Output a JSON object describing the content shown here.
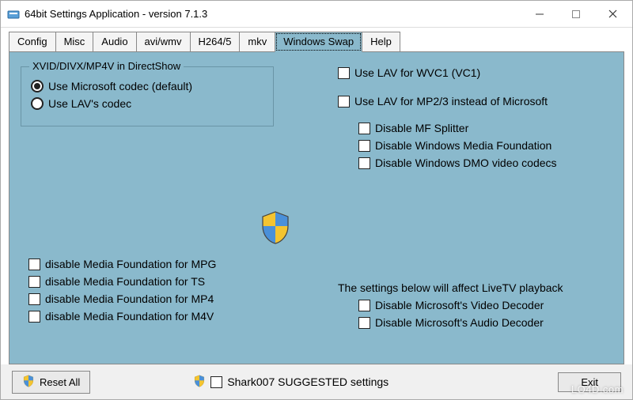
{
  "window": {
    "title": "64bit Settings Application - version 7.1.3"
  },
  "tabs": [
    {
      "label": "Config"
    },
    {
      "label": "Misc"
    },
    {
      "label": "Audio"
    },
    {
      "label": "avi/wmv"
    },
    {
      "label": "H264/5"
    },
    {
      "label": "mkv"
    },
    {
      "label": "Windows Swap"
    },
    {
      "label": "Help"
    }
  ],
  "active_tab_index": 6,
  "group": {
    "legend": "XVID/DIVX/MP4V in DirectShow",
    "radio_ms": "Use Microsoft codec (default)",
    "radio_lav": "Use LAV's codec",
    "selected": "ms"
  },
  "right": {
    "lav_wvc1": "Use LAV for WVC1 (VC1)",
    "lav_mp23": "Use LAV for MP2/3 instead of Microsoft",
    "disable_mf_splitter": "Disable MF Splitter",
    "disable_wmf": "Disable Windows Media Foundation",
    "disable_dmo": "Disable Windows DMO video codecs"
  },
  "left_lower": {
    "mf_mpg": "disable Media Foundation for MPG",
    "mf_ts": "disable Media Foundation for TS",
    "mf_mp4": "disable Media Foundation for MP4",
    "mf_m4v": "disable Media Foundation for M4V"
  },
  "right_lower": {
    "caption": "The settings below will affect LiveTV playback",
    "disable_ms_video": "Disable Microsoft's Video Decoder",
    "disable_ms_audio": "Disable Microsoft's Audio Decoder"
  },
  "footer": {
    "reset_all": "Reset All",
    "suggested": "Shark007 SUGGESTED settings",
    "exit": "Exit"
  },
  "watermark": "LO4D.com"
}
